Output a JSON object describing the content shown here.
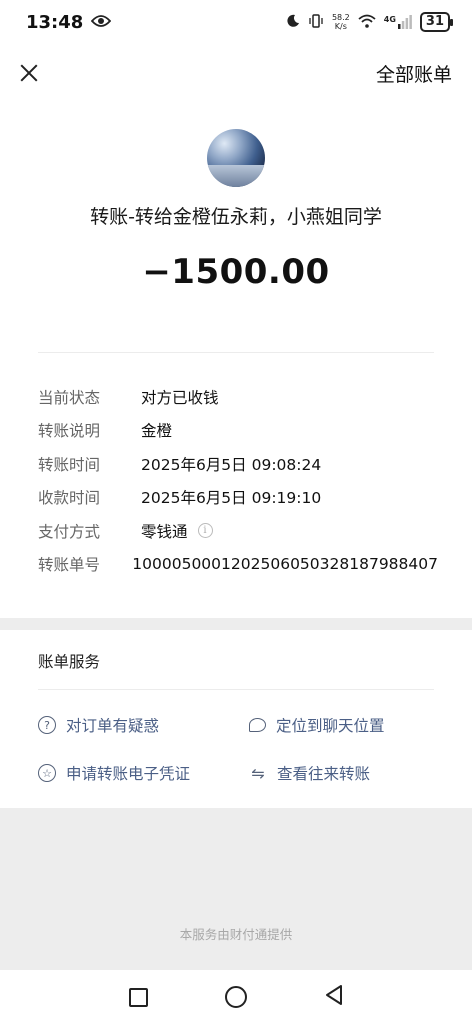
{
  "status_bar": {
    "time": "13:48",
    "net_speed_value": "58.2",
    "net_speed_unit": "K/s",
    "network": "4G",
    "battery": "31"
  },
  "topbar": {
    "all_bills_label": "全部账单"
  },
  "transfer": {
    "title": "转账-转给金橙伍永莉，小燕姐同学",
    "amount": "−1500.00",
    "details": [
      {
        "label": "当前状态",
        "value": "对方已收钱"
      },
      {
        "label": "转账说明",
        "value": "金橙"
      },
      {
        "label": "转账时间",
        "value": "2025年6月5日 09:08:24"
      },
      {
        "label": "收款时间",
        "value": "2025年6月5日 09:19:10"
      },
      {
        "label": "支付方式",
        "value": "零钱通"
      },
      {
        "label": "转账单号",
        "value": "1000050001202506050328187988407"
      }
    ]
  },
  "services": {
    "title": "账单服务",
    "items": [
      {
        "label": "对订单有疑惑",
        "icon": "question-icon"
      },
      {
        "label": "定位到聊天位置",
        "icon": "chat-bubble-icon"
      },
      {
        "label": "申请转账电子凭证",
        "icon": "star-badge-icon"
      },
      {
        "label": "查看往来转账",
        "icon": "swap-arrows-icon"
      }
    ]
  },
  "footer": {
    "provider_text": "本服务由财付通提供"
  }
}
